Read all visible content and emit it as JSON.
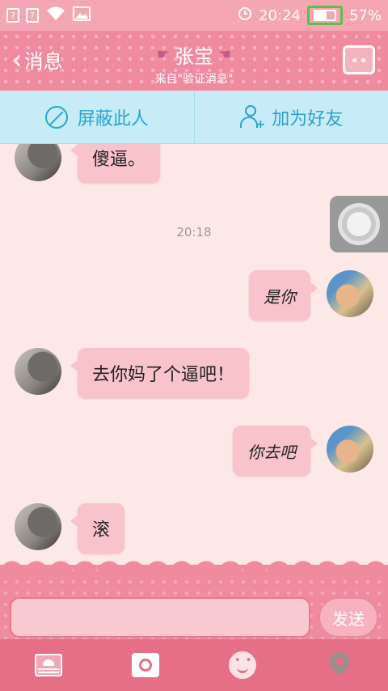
{
  "status_bar": {
    "time": "20:24",
    "battery_text": "57%",
    "battery_level": 0.57
  },
  "header": {
    "back_label": "消息",
    "title": "张宝",
    "subtitle": "来自\"验证消息\""
  },
  "actions": {
    "block_label": "屏蔽此人",
    "add_friend_label": "加为好友"
  },
  "messages": [
    {
      "side": "left",
      "text": "傻逼。"
    },
    {
      "side": "right",
      "text": "是你"
    },
    {
      "side": "left",
      "text": "去你妈了个逼吧！"
    },
    {
      "side": "right",
      "text": "你去吧"
    },
    {
      "side": "left",
      "text": "滚"
    }
  ],
  "timestamp": "20:18",
  "composer": {
    "input_value": "",
    "send_label": "发送"
  },
  "colors": {
    "header": "#f08a9e",
    "action_bar": "#c7ecf7",
    "accent_blue": "#2ba3d0",
    "bubble": "#f8c3cb",
    "toolbar": "#e56f87"
  }
}
